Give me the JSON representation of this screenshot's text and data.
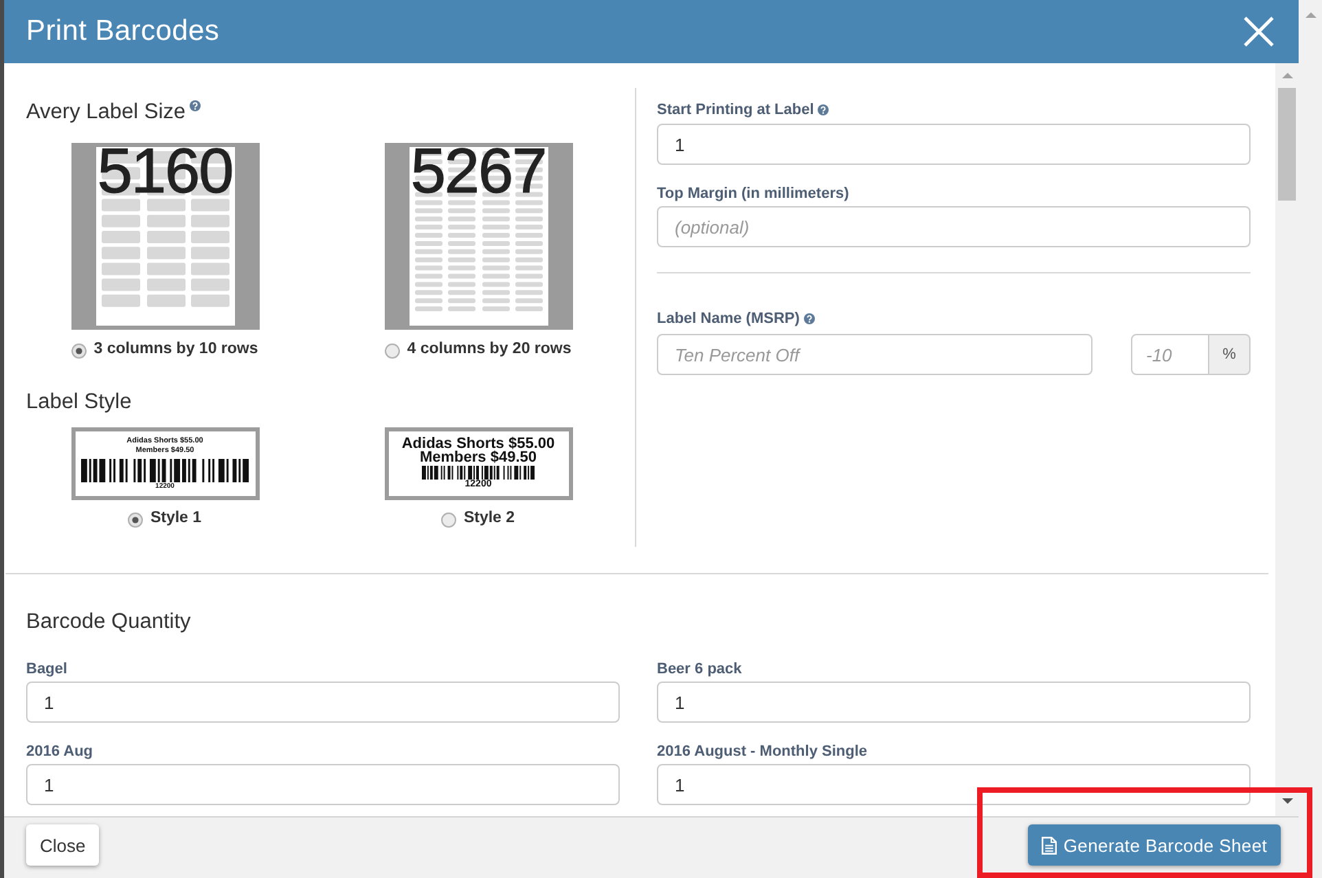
{
  "window": {
    "title": "Print Barcodes"
  },
  "label_size": {
    "heading": "Avery Label Size",
    "help": true,
    "options": [
      {
        "kind": "three-column",
        "sheet_number": "5160",
        "label": "3 columns by 10 rows",
        "selected": true
      },
      {
        "kind": "four-column",
        "sheet_number": "5267",
        "label": "4 columns by 20 rows",
        "selected": false
      }
    ]
  },
  "label_style": {
    "heading": "Label Style",
    "options": [
      {
        "kind": "small-text",
        "lines": [
          "Adidas Shorts $55.00",
          "Members $49.50"
        ],
        "code": "12200",
        "label": "Style 1",
        "selected": true
      },
      {
        "kind": "large-text",
        "lines": [
          "Adidas Shorts $55.00",
          "Members $49.50"
        ],
        "code": "12200",
        "label": "Style 2",
        "selected": false
      }
    ]
  },
  "start_printing": {
    "label": "Start Printing at Label",
    "help": true,
    "value": "1"
  },
  "top_margin": {
    "label": "Top Margin (in millimeters)",
    "help": false,
    "placeholder": "(optional)"
  },
  "label_name": {
    "label": "Label Name (MSRP)",
    "help": true,
    "placeholder": "Ten Percent Off",
    "discount": {
      "placeholder": "-10",
      "unit": "%"
    }
  },
  "barcode_quantity": {
    "heading": "Barcode Quantity",
    "items": [
      {
        "label": "Bagel",
        "value": "1"
      },
      {
        "label": "Beer 6 pack",
        "value": "1"
      },
      {
        "label": "2016 Aug",
        "value": "1"
      },
      {
        "label": "2016 August - Monthly Single",
        "value": "1"
      }
    ]
  },
  "footer": {
    "close": "Close",
    "generate": "Generate Barcode Sheet"
  }
}
